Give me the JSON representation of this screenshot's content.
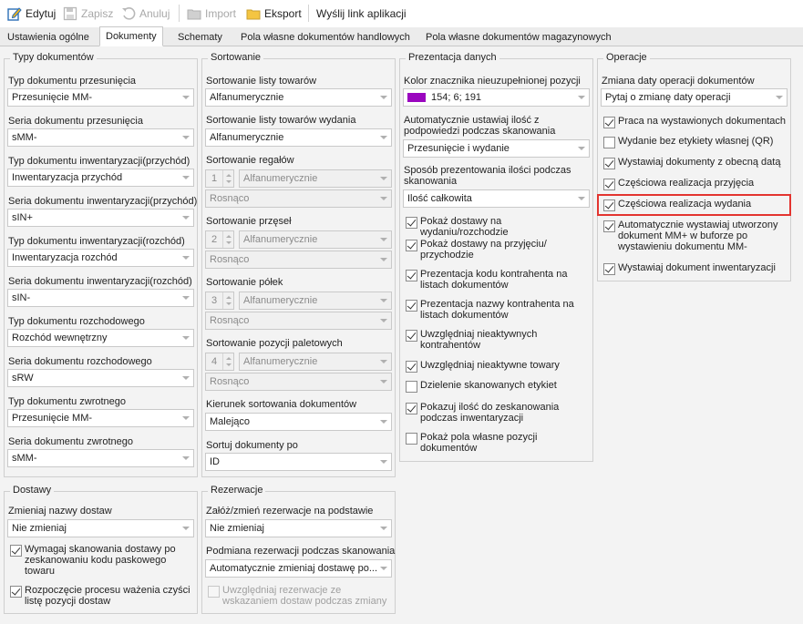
{
  "toolbar": {
    "edit": "Edytuj",
    "save": "Zapisz",
    "cancel": "Anuluj",
    "import": "Import",
    "export": "Eksport",
    "send_link": "Wyślij link aplikacji"
  },
  "tabs": [
    "Ustawienia ogólne",
    "Dokumenty",
    "Schematy",
    "Pola własne dokumentów handlowych",
    "Pola własne dokumentów magazynowych"
  ],
  "typy": {
    "title": "Typy dokumentów",
    "fields": [
      {
        "label": "Typ dokumentu przesunięcia",
        "value": "Przesunięcie MM-"
      },
      {
        "label": "Seria dokumentu przesunięcia",
        "value": "sMM-"
      },
      {
        "label": "Typ dokumentu inwentaryzacji(przychód)",
        "value": "Inwentaryzacja przychód"
      },
      {
        "label": "Seria dokumentu inwentaryzacji(przychód)",
        "value": "sIN+"
      },
      {
        "label": "Typ dokumentu inwentaryzacji(rozchód)",
        "value": "Inwentaryzacja rozchód"
      },
      {
        "label": "Seria dokumentu inwentaryzacji(rozchód)",
        "value": "sIN-"
      },
      {
        "label": "Typ dokumentu rozchodowego",
        "value": "Rozchód wewnętrzny"
      },
      {
        "label": "Seria dokumentu rozchodowego",
        "value": "sRW"
      },
      {
        "label": "Typ dokumentu zwrotnego",
        "value": "Przesunięcie MM-"
      },
      {
        "label": "Seria dokumentu zwrotnego",
        "value": "sMM-"
      }
    ]
  },
  "sortowanie": {
    "title": "Sortowanie",
    "lista_towarow_label": "Sortowanie listy towarów",
    "lista_towarow_value": "Alfanumerycznie",
    "lista_wydania_label": "Sortowanie listy towarów wydania",
    "lista_wydania_value": "Alfanumerycznie",
    "regalow_label": "Sortowanie regałów",
    "regalow_num": "1",
    "regalow_value": "Alfanumerycznie",
    "regalow_dir": "Rosnąco",
    "przesel_label": "Sortowanie przęseł",
    "przesel_num": "2",
    "przesel_value": "Alfanumerycznie",
    "przesel_dir": "Rosnąco",
    "polek_label": "Sortowanie półek",
    "polek_num": "3",
    "polek_value": "Alfanumerycznie",
    "polek_dir": "Rosnąco",
    "paletowych_label": "Sortowanie pozycji paletowych",
    "paletowych_num": "4",
    "paletowych_value": "Alfanumerycznie",
    "paletowych_dir": "Rosnąco",
    "kierunek_label": "Kierunek sortowania dokumentów",
    "kierunek_value": "Malejąco",
    "sortuj_label": "Sortuj dokumenty po",
    "sortuj_value": "ID"
  },
  "prezentacja": {
    "title": "Prezentacja danych",
    "kolor_label": "Kolor znacznika nieuzupełnionej pozycji",
    "kolor_value": "154; 6; 191",
    "kolor_hex": "#9a06bf",
    "auto_label": "Automatycznie ustawiaj ilość z podpowiedzi podczas skanowania",
    "auto_value": "Przesunięcie i wydanie",
    "sposob_label": "Sposób prezentowania ilości podczas skanowania",
    "sposob_value": "Ilość całkowita",
    "checks": [
      {
        "label": "Pokaż dostawy na wydaniu/rozchodzie",
        "checked": true
      },
      {
        "label": "Pokaż dostawy na przyjęciu/ przychodzie",
        "checked": true
      },
      {
        "label": "Prezentacja kodu kontrahenta na listach dokumentów",
        "checked": true
      },
      {
        "label": "Prezentacja nazwy kontrahenta na listach dokumentów",
        "checked": true
      },
      {
        "label": "Uwzględniaj nieaktywnych kontrahentów",
        "checked": true
      },
      {
        "label": "Uwzględniaj nieaktywne towary",
        "checked": true
      },
      {
        "label": "Dzielenie skanowanych etykiet",
        "checked": false
      },
      {
        "label": "Pokazuj ilość do zeskanowania podczas inwentaryzacji",
        "checked": true
      },
      {
        "label": "Pokaż pola własne pozycji dokumentów",
        "checked": false
      }
    ]
  },
  "operacje": {
    "title": "Operacje",
    "zmiana_label": "Zmiana daty operacji dokumentów",
    "zmiana_value": "Pytaj o zmianę daty operacji",
    "checks": [
      {
        "label": "Praca na wystawionych dokumentach",
        "checked": true
      },
      {
        "label": "Wydanie bez etykiety własnej (QR)",
        "checked": false
      },
      {
        "label": "Wystawiaj dokumenty z obecną datą",
        "checked": true
      },
      {
        "label": "Częściowa realizacja przyjęcia",
        "checked": true
      },
      {
        "label": "Częściowa realizacja wydania",
        "checked": true
      },
      {
        "label": "Automatycznie wystawiaj utworzony dokument MM+ w buforze po wystawieniu dokumentu MM-",
        "checked": true
      },
      {
        "label": "Wystawiaj dokument inwentaryzacji",
        "checked": true
      }
    ]
  },
  "dostawy": {
    "title": "Dostawy",
    "zmieniaj_label": "Zmieniaj nazwy dostaw",
    "zmieniaj_value": "Nie zmieniaj",
    "checks": [
      {
        "label": "Wymagaj skanowania dostawy po zeskanowaniu kodu paskowego towaru",
        "checked": true
      },
      {
        "label": "Rozpoczęcie procesu ważenia czyści listę pozycji dostaw",
        "checked": true
      }
    ]
  },
  "rezerwacje": {
    "title": "Rezerwacje",
    "zaloz_label": "Załóż/zmień rezerwacje na podstawie",
    "zaloz_value": "Nie zmieniaj",
    "podmiana_label": "Podmiana rezerwacji podczas skanowania",
    "podmiana_value": "Automatycznie zmieniaj dostawę po...",
    "uwzgl_label": "Uwzględniaj rezerwacje ze wskazaniem dostaw podczas zmiany"
  }
}
